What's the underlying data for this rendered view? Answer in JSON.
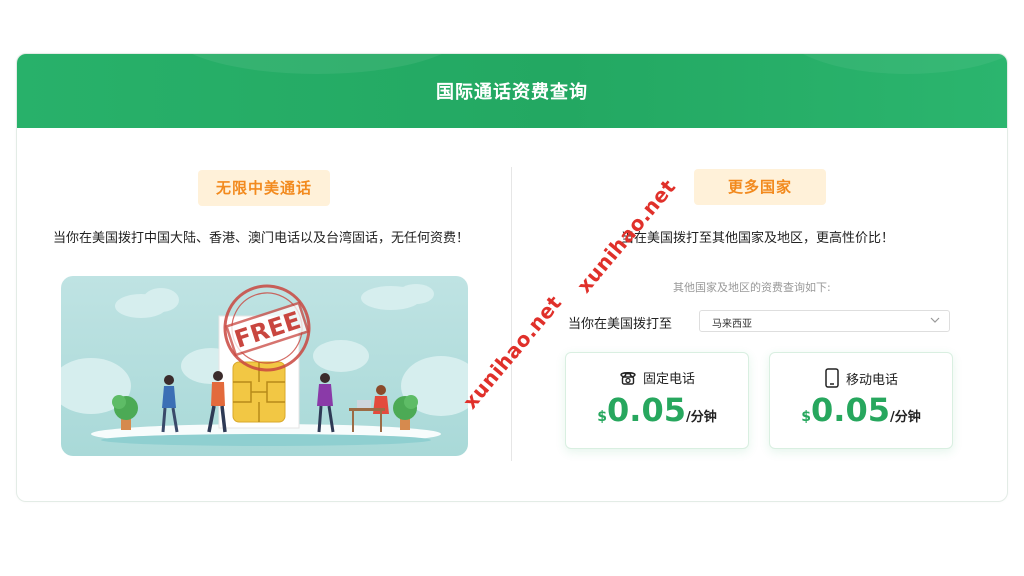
{
  "header": {
    "title": "国际通话资费查询"
  },
  "left": {
    "badge": "无限中美通话",
    "description": "当你在美国拨打中国大陆、香港、澳门电话以及台湾固话，无任何资费！",
    "illustration_stamp": "FREE"
  },
  "right": {
    "badge": "更多国家",
    "description": "当在美国拨打至其他国家及地区，更高性价比！",
    "sub_description": "其他国家及地区的资费查询如下:",
    "destination_label": "当你在美国拨打至",
    "destination_value": "马来西亚",
    "rates": {
      "fixed": {
        "label": "固定电话",
        "currency": "$",
        "price": "0.05",
        "unit": "/分钟",
        "icon": "telephone-icon"
      },
      "mobile": {
        "label": "移动电话",
        "currency": "$",
        "price": "0.05",
        "unit": "/分钟",
        "icon": "mobile-phone-icon"
      }
    }
  },
  "watermarks": [
    "xunihao.net",
    "xunihao.net"
  ],
  "colors": {
    "brand_green": "#27a75e",
    "badge_bg": "#fff1d9",
    "badge_text": "#f28a1e",
    "watermark": "#e0302a"
  }
}
